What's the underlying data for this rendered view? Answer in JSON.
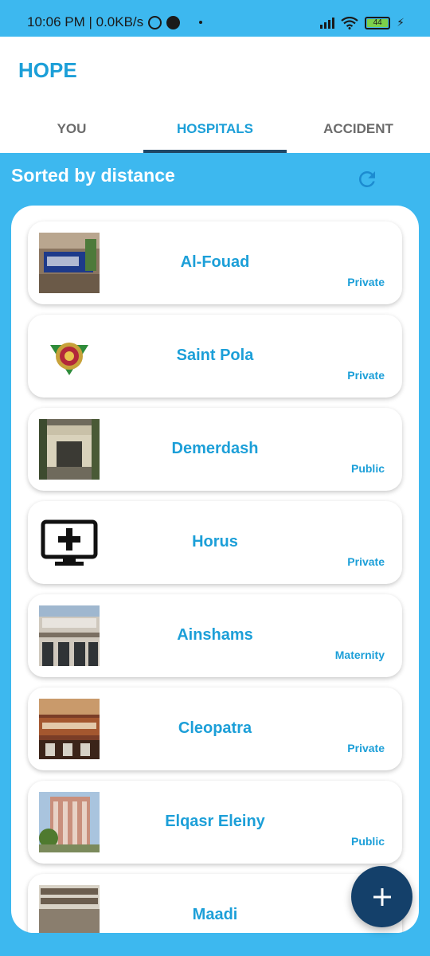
{
  "status_bar": {
    "time_speed": "10:06 PM | 0.0KB/s",
    "battery": "44"
  },
  "app": {
    "title": "HOPE"
  },
  "tabs": [
    {
      "label": "YOU"
    },
    {
      "label": "HOSPITALS"
    },
    {
      "label": "ACCIDENT"
    }
  ],
  "active_tab": "HOSPITALS",
  "header": {
    "sorted_label": "Sorted by distance"
  },
  "hospitals": [
    {
      "name": "Al-Fouad",
      "type": "Private"
    },
    {
      "name": "Saint Pola",
      "type": "Private"
    },
    {
      "name": "Demerdash",
      "type": "Public"
    },
    {
      "name": "Horus",
      "type": "Private"
    },
    {
      "name": "Ainshams",
      "type": "Maternity"
    },
    {
      "name": "Cleopatra",
      "type": "Private"
    },
    {
      "name": "Elqasr Eleiny",
      "type": "Public"
    },
    {
      "name": "Maadi",
      "type": ""
    }
  ],
  "icons": {
    "refresh": "refresh-icon",
    "fab": "add-icon"
  },
  "colors": {
    "accent": "#1c9fd8",
    "background": "#3db8ef",
    "tab_indicator": "#1f4766",
    "fab": "#14406a"
  }
}
